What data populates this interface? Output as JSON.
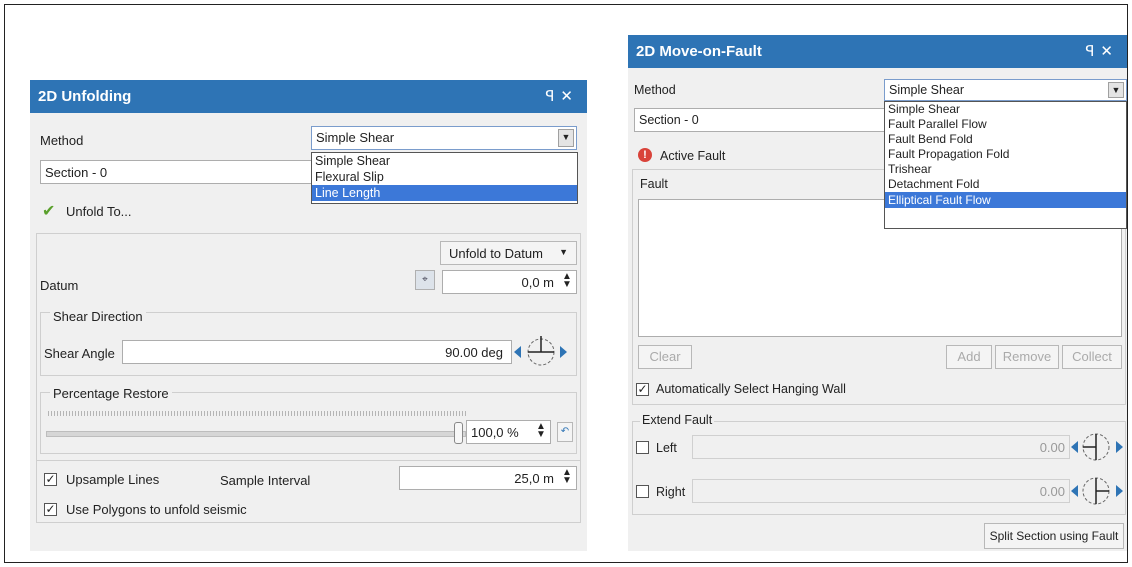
{
  "unfold": {
    "title": "2D Unfolding",
    "pin_icon": "ꟼ",
    "close_icon": "✕",
    "method_label": "Method",
    "method_value": "Simple Shear",
    "method_options": [
      "Simple Shear",
      "Flexural Slip",
      "Line Length"
    ],
    "section_value": "Section - 0",
    "unfold_to_label": "Unfold To...",
    "unfold_mode": "Unfold to Datum",
    "datum_label": "Datum",
    "datum_value": "0,0 m",
    "shear_direction_label": "Shear Direction",
    "shear_angle_label": "Shear Angle",
    "shear_angle_value": "90.00 deg",
    "percentage_restore_label": "Percentage Restore",
    "percentage_value": "100,0 %",
    "upsample_label": "Upsample Lines",
    "sample_interval_label": "Sample Interval",
    "sample_interval_value": "25,0 m",
    "polygons_label": "Use Polygons to unfold seismic"
  },
  "fault": {
    "title": "2D Move-on-Fault",
    "pin_icon": "ꟼ",
    "close_icon": "✕",
    "method_label": "Method",
    "method_value": "Simple Shear",
    "method_options": [
      "Simple Shear",
      "Fault Parallel Flow",
      "Fault Bend Fold",
      "Fault Propagation Fold",
      "Trishear",
      "Detachment Fold",
      "Elliptical Fault Flow"
    ],
    "section_value": "Section - 0",
    "active_fault_label": "Active Fault",
    "fault_label": "Fault",
    "clear_label": "Clear",
    "add_label": "Add",
    "remove_label": "Remove",
    "collect_label": "Collect",
    "auto_select_label": "Automatically Select Hanging Wall",
    "extend_fault_label": "Extend Fault",
    "left_label": "Left",
    "left_value": "0.00",
    "right_label": "Right",
    "right_value": "0.00",
    "split_label": "Split Section using Fault"
  }
}
